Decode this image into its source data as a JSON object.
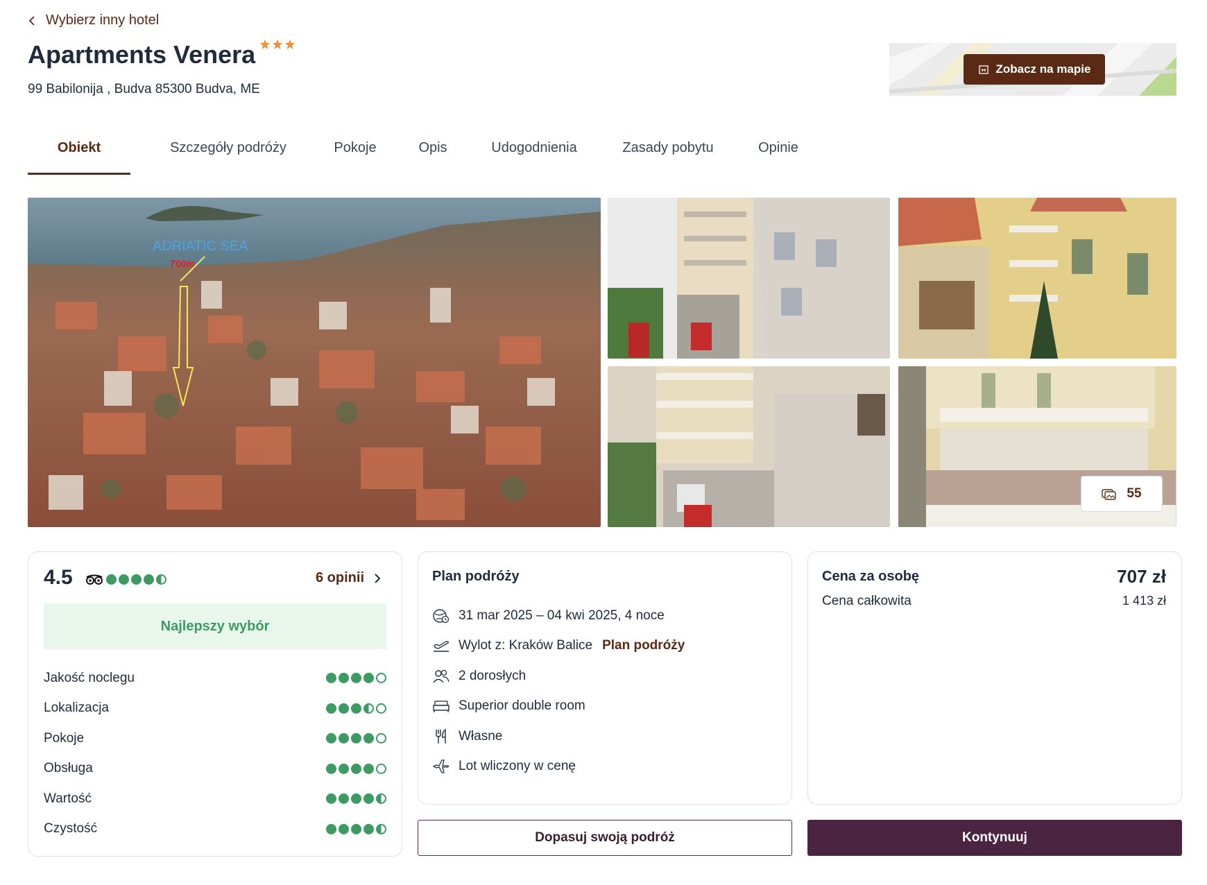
{
  "nav": {
    "back_label": "Wybierz inny hotel"
  },
  "hotel": {
    "name": "Apartments Venera",
    "stars": 3,
    "address": "99 Babilonija , Budva 85300 Budva, ME"
  },
  "map": {
    "button_label": "Zobacz na mapie"
  },
  "tabs": [
    {
      "label": "Obiekt",
      "active": true
    },
    {
      "label": "Szczegóły podróży"
    },
    {
      "label": "Pokoje"
    },
    {
      "label": "Opis"
    },
    {
      "label": "Udogodnienia"
    },
    {
      "label": "Zasady pobytu"
    },
    {
      "label": "Opinie"
    }
  ],
  "gallery": {
    "main_overlay": {
      "sea_label": "ADRIATIC SEA",
      "distance_label": "700m"
    },
    "photo_count": "55"
  },
  "rating": {
    "score": "4.5",
    "score_dots": 4.5,
    "reviews_label": "6 opinii",
    "badge": "Najlepszy wybór",
    "criteria": [
      {
        "label": "Jakość noclegu",
        "value": 4
      },
      {
        "label": "Lokalizacja",
        "value": 3.5
      },
      {
        "label": "Pokoje",
        "value": 4
      },
      {
        "label": "Obsługa",
        "value": 4
      },
      {
        "label": "Wartość",
        "value": 4.5
      },
      {
        "label": "Czystość",
        "value": 4.5
      }
    ]
  },
  "plan": {
    "title": "Plan podróży",
    "dates": "31 mar 2025 – 04 kwi 2025, 4 noce",
    "departure": "Wylot z: Kraków Balice",
    "departure_link": "Plan podróży",
    "guests": "2 dorosłych",
    "room": "Superior double room",
    "board": "Własne",
    "flight": "Lot wliczony w cenę"
  },
  "price": {
    "per_person_label": "Cena za osobę",
    "per_person_value": "707 zł",
    "total_label": "Cena całkowita",
    "total_value": "1 413 zł"
  },
  "actions": {
    "customize_label": "Dopasuj swoją podróż",
    "continue_label": "Kontynuuj"
  },
  "colors": {
    "brand": "#5a2a14",
    "primary_button": "#4a2441",
    "rating_green": "#3d9a63",
    "badge_bg": "#e8f6ec"
  }
}
